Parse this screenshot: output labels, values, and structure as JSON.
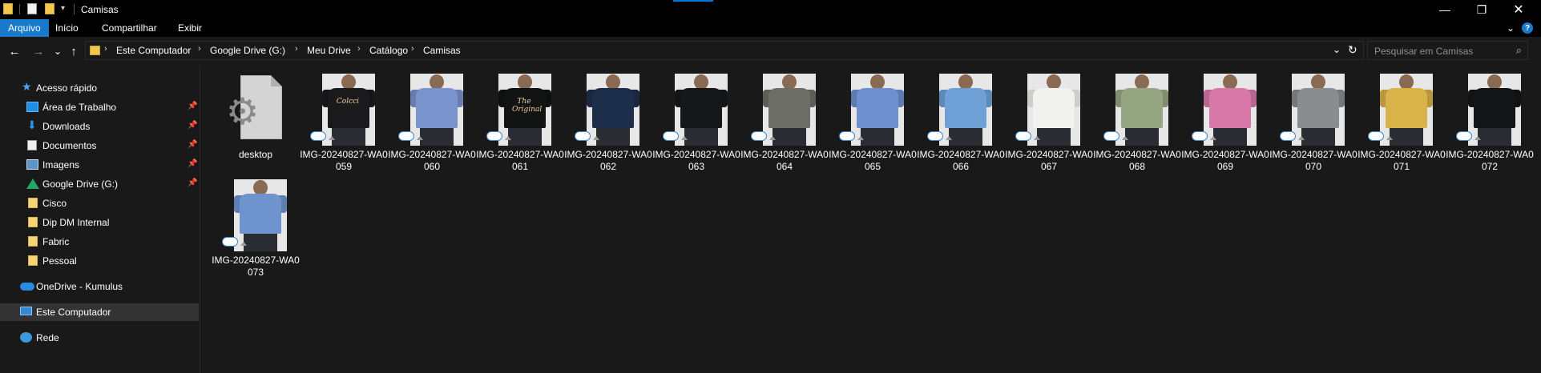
{
  "window": {
    "title": "Camisas",
    "minimize_symbol": "—",
    "maximize_symbol": "❐",
    "close_symbol": "✕"
  },
  "ribbon": {
    "tabs": [
      "Arquivo",
      "Início",
      "Compartilhar",
      "Exibir"
    ],
    "active_tab": "Arquivo",
    "accent_color": "#1979ca"
  },
  "navigation": {
    "back_symbol": "←",
    "forward_symbol": "→",
    "recent_symbol": "⌄",
    "up_symbol": "↑"
  },
  "address": {
    "breadcrumb": [
      "Este Computador",
      "Google Drive (G:)",
      "Meu Drive",
      "Catálogo",
      "Camisas"
    ],
    "separator": "›"
  },
  "search": {
    "placeholder": "Pesquisar em Camisas"
  },
  "sidebar": {
    "quick_access": "Acesso rápido",
    "pinned": [
      {
        "label": "Área de Trabalho",
        "icon": "desktop-icon"
      },
      {
        "label": "Downloads",
        "icon": "download-icon"
      },
      {
        "label": "Documentos",
        "icon": "documents-icon"
      },
      {
        "label": "Imagens",
        "icon": "pictures-icon"
      },
      {
        "label": "Google Drive (G:)",
        "icon": "google-drive-icon"
      }
    ],
    "folders": [
      "Cisco",
      "Dip DM Internal",
      "Fabric",
      "Pessoal"
    ],
    "onedrive": "OneDrive - Kumulus",
    "this_pc": "Este Computador",
    "network": "Rede"
  },
  "files": [
    {
      "name": "desktop",
      "type": "ini"
    },
    {
      "name": "IMG-20240827-WA0059",
      "shirt_color": "#1a1a1c",
      "print": "Colcci"
    },
    {
      "name": "IMG-20240827-WA0060",
      "shirt_color": "#7a93cc",
      "print": ""
    },
    {
      "name": "IMG-20240827-WA0061",
      "shirt_color": "#121414",
      "print": "The Original"
    },
    {
      "name": "IMG-20240827-WA0062",
      "shirt_color": "#1d2e4a",
      "print": ""
    },
    {
      "name": "IMG-20240827-WA0063",
      "shirt_color": "#151719",
      "print": ""
    },
    {
      "name": "IMG-20240827-WA0064",
      "shirt_color": "#6e6e69",
      "print": ""
    },
    {
      "name": "IMG-20240827-WA0065",
      "shirt_color": "#6f8fcf",
      "print": ""
    },
    {
      "name": "IMG-20240827-WA0066",
      "shirt_color": "#6fa0d6",
      "print": ""
    },
    {
      "name": "IMG-20240827-WA0067",
      "shirt_color": "#f1f1ef",
      "print": ""
    },
    {
      "name": "IMG-20240827-WA0068",
      "shirt_color": "#96a683",
      "print": ""
    },
    {
      "name": "IMG-20240827-WA0069",
      "shirt_color": "#d878a8",
      "print": ""
    },
    {
      "name": "IMG-20240827-WA0070",
      "shirt_color": "#8a8d8f",
      "print": ""
    },
    {
      "name": "IMG-20240827-WA0071",
      "shirt_color": "#d9b24a",
      "print": ""
    },
    {
      "name": "IMG-20240827-WA0072",
      "shirt_color": "#141516",
      "print": ""
    },
    {
      "name": "IMG-20240827-WA0073",
      "shirt_color": "#6e93cf",
      "print": ""
    }
  ]
}
